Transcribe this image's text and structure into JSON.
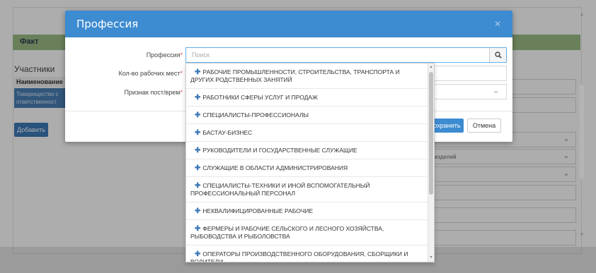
{
  "background": {
    "fact_label": "Факт",
    "participants_label": "Участники",
    "name_column": "Наименование",
    "row_text_line1": "Товарищество с",
    "row_text_line2": "ответственност",
    "add_button": "Добавить",
    "products_field": "изделий"
  },
  "modal": {
    "title": "Профессия",
    "close_icon": "close-icon",
    "fields": [
      {
        "label": "Профессия",
        "required": "*"
      },
      {
        "label": "Кол-во рабочих мест",
        "required": "*"
      },
      {
        "label": "Признак пост/врем",
        "required": "*"
      }
    ],
    "save_button": "Сохранить",
    "save_button_visible": "охранить",
    "cancel_button": "Отмена"
  },
  "search": {
    "placeholder": "Поиск",
    "value": "",
    "icon": "search-icon"
  },
  "dropdown": {
    "items": [
      "РАБОЧИЕ ПРОМЫШЛЕННОСТИ, СТРОИТЕЛЬСТВА, ТРАНСПОРТА И ДРУГИХ РОДСТВЕННЫХ ЗАНЯТИЙ",
      "РАБОТНИКИ СФЕРЫ УСЛУГ И ПРОДАЖ",
      "СПЕЦИАЛИСТЫ-ПРОФЕССИОНАЛЫ",
      "БАСТАУ-БИЗНЕС",
      "РУКОВОДИТЕЛИ И ГОСУДАРСТВЕННЫЕ СЛУЖАЩИЕ",
      "СЛУЖАЩИЕ В ОБЛАСТИ АДМИНИСТРИРОВАНИЯ",
      "СПЕЦИАЛИСТЫ-ТЕХНИКИ И ИНОЙ ВСПОМОГАТЕЛЬНЫЙ ПРОФЕССИОНАЛЬНЫЙ ПЕРСОНАЛ",
      "НЕКВАЛИФИЦИРОВАННЫЕ РАБОЧИЕ",
      "ФЕРМЕРЫ И РАБОЧИЕ СЕЛЬСКОГО И ЛЕСНОГО ХОЗЯЙСТВА, РЫБОВОДСТВА И РЫБОЛОВСТВА",
      "ОПЕРАТОРЫ ПРОИЗВОДСТВЕННОГО ОБОРУДОВАНИЯ, СБОРЩИКИ И ВОДИТЕЛИ"
    ],
    "item_icon": "plus-icon"
  },
  "colors": {
    "modal_header": "#3d8bd0",
    "fact_bar": "#9bbd86",
    "primary_button": "#3d8bd0",
    "required_mark": "#d9534f"
  }
}
